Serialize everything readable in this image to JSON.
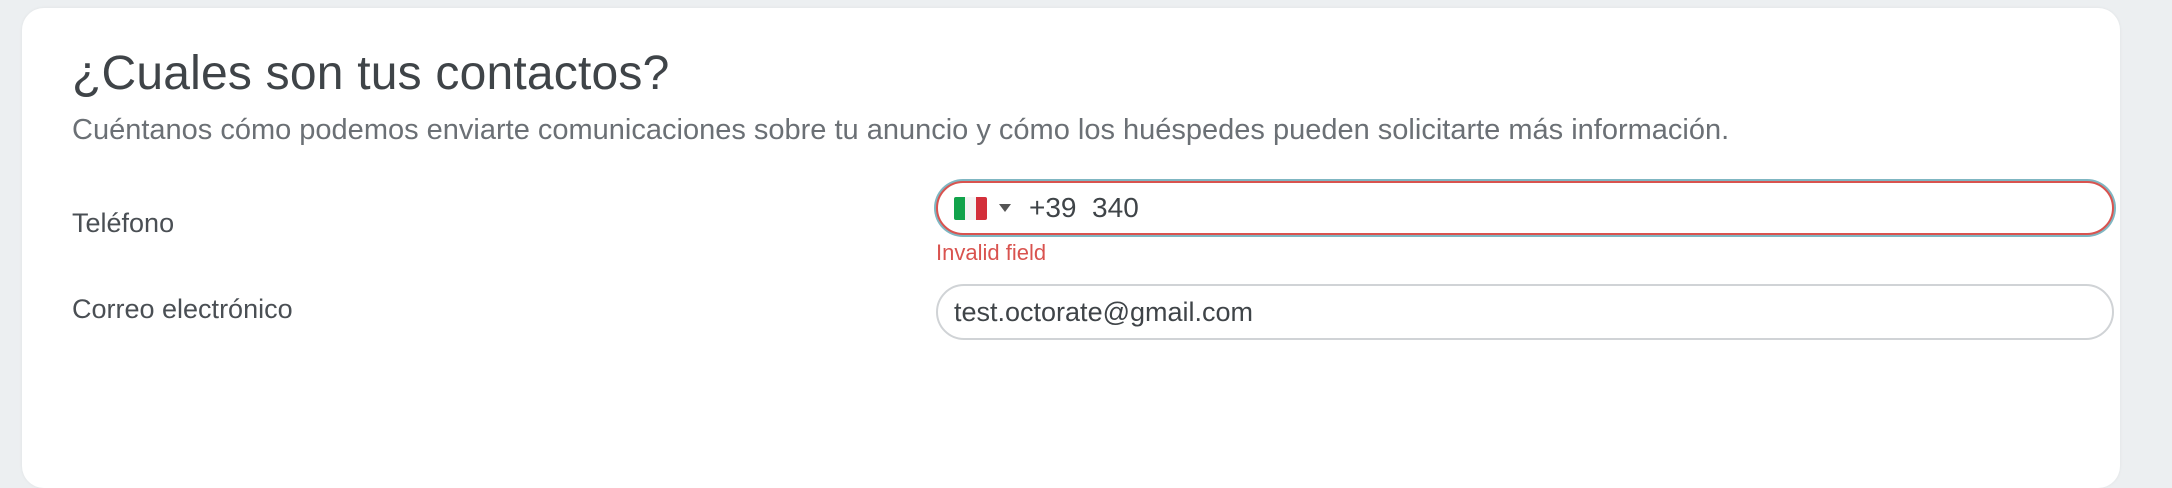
{
  "section": {
    "title": "¿Cuales son tus contactos?",
    "subtitle": "Cuéntanos cómo podemos enviarte comunicaciones sobre tu anuncio y cómo los huéspedes pueden solicitarte más información."
  },
  "phone": {
    "label": "Teléfono",
    "country_flag": "italy-flag",
    "value": "+39  340",
    "error": "Invalid field"
  },
  "email": {
    "label": "Correo electrónico",
    "value": "test.octorate@gmail.com"
  },
  "colors": {
    "error": "#d9534f",
    "focus_ring": "#7fb6c2",
    "text": "#3f4448"
  }
}
